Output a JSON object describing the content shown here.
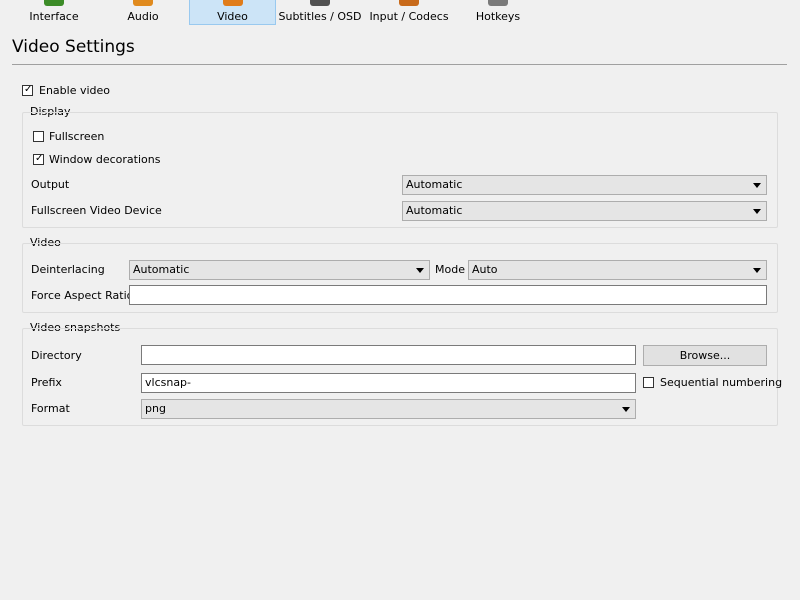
{
  "tabs": [
    {
      "label": "Interface",
      "selected": false,
      "icon": "interface-icon",
      "icon_color": "#3c8c28"
    },
    {
      "label": "Audio",
      "selected": false,
      "icon": "audio-icon",
      "icon_color": "#e08a1e"
    },
    {
      "label": "Video",
      "selected": true,
      "icon": "video-icon",
      "icon_color": "#e07c1a"
    },
    {
      "label": "Subtitles / OSD",
      "selected": false,
      "icon": "subtitles-icon",
      "icon_color": "#505050"
    },
    {
      "label": "Input / Codecs",
      "selected": false,
      "icon": "input-codecs-icon",
      "icon_color": "#c86a1a"
    },
    {
      "label": "Hotkeys",
      "selected": false,
      "icon": "hotkeys-icon",
      "icon_color": "#7a7a7a"
    }
  ],
  "page_title": "Video Settings",
  "enable_video": {
    "label": "Enable video",
    "checked": true
  },
  "display": {
    "title": "Display",
    "fullscreen": {
      "label": "Fullscreen",
      "checked": false
    },
    "window_decorations": {
      "label": "Window decorations",
      "checked": true
    },
    "output": {
      "label": "Output",
      "value": "Automatic"
    },
    "fullscreen_device": {
      "label": "Fullscreen Video Device",
      "value": "Automatic"
    }
  },
  "video": {
    "title": "Video",
    "deinterlacing": {
      "label": "Deinterlacing",
      "value": "Automatic"
    },
    "mode": {
      "label": "Mode",
      "value": "Auto"
    },
    "aspect_ratio": {
      "label": "Force Aspect Ratio",
      "value": ""
    }
  },
  "snapshots": {
    "title": "Video snapshots",
    "directory": {
      "label": "Directory",
      "value": ""
    },
    "browse_label": "Browse...",
    "prefix": {
      "label": "Prefix",
      "value": "vlcsnap-"
    },
    "sequential": {
      "label": "Sequential numbering",
      "checked": false
    },
    "format": {
      "label": "Format",
      "value": "png"
    }
  },
  "colors": {
    "selected_tab_bg": "#cce4f7",
    "selected_tab_border": "#99c9ef"
  }
}
